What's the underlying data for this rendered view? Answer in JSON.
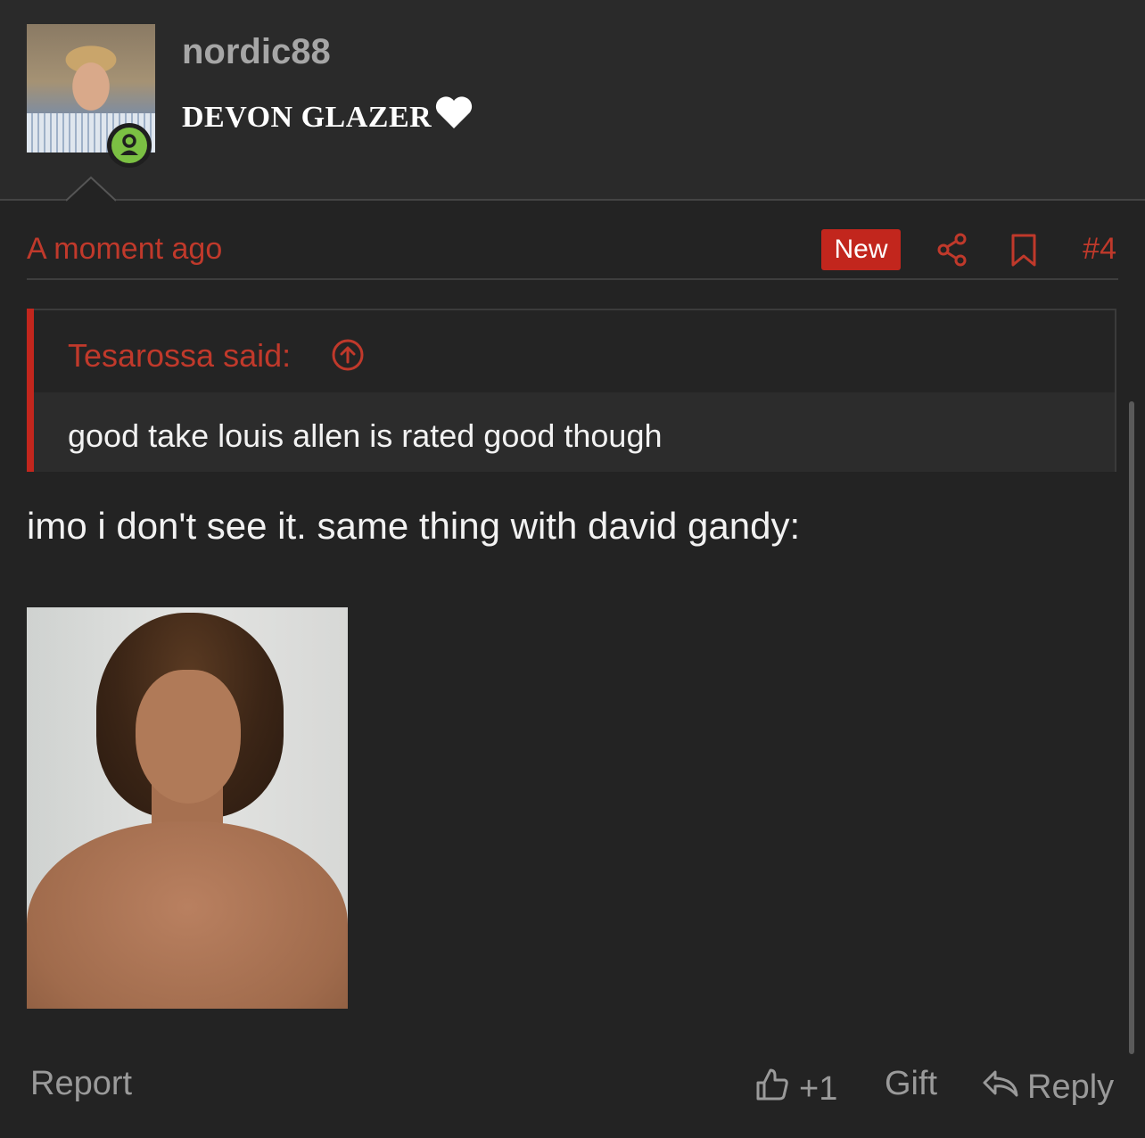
{
  "author": {
    "username": "nordic88",
    "title": "DEVON GLAZER",
    "avatar_icon": "user-avatar-photo",
    "status_icon": "online-user-icon"
  },
  "post": {
    "timestamp": "A moment ago",
    "new_badge": "New",
    "post_number": "#4",
    "quote": {
      "author": "Tesarossa said:",
      "text": "good take louis allen is rated good though"
    },
    "message": "imo i don't see it. same thing with david gandy:"
  },
  "footer": {
    "report": "Report",
    "like": "+1",
    "gift": "Gift",
    "reply": "Reply"
  },
  "colors": {
    "accent": "#c2261d",
    "online": "#7bc043",
    "background": "#232323"
  }
}
